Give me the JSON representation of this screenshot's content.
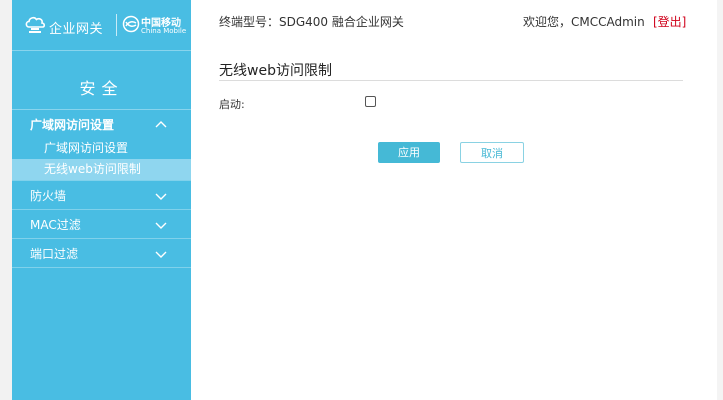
{
  "brand": {
    "product_name": "企业网关",
    "operator_cn": "中国移动",
    "operator_en": "China Mobile"
  },
  "sidebar": {
    "section_title": "安全",
    "groups": [
      {
        "label": "广域网访问设置",
        "expanded": true,
        "items": [
          {
            "label": "广域网访问设置",
            "active": false
          },
          {
            "label": "无线web访问限制",
            "active": true
          }
        ]
      },
      {
        "label": "防火墙",
        "expanded": false
      },
      {
        "label": "MAC过滤",
        "expanded": false
      },
      {
        "label": "端口过滤",
        "expanded": false
      }
    ]
  },
  "header": {
    "device_model": "终端型号：SDG400 融合企业网关",
    "welcome": "欢迎您，CMCCAdmin",
    "logout": "[登出]"
  },
  "main": {
    "title": "无线web访问限制",
    "enable_label": "启动:",
    "enable_checked": false,
    "apply_label": "应用",
    "cancel_label": "取消"
  },
  "colors": {
    "sidebar_bg": "#49bde3",
    "active_item_bg": "#8fd6ef",
    "button_primary": "#45b9d6",
    "logout_red": "#d0021b"
  }
}
